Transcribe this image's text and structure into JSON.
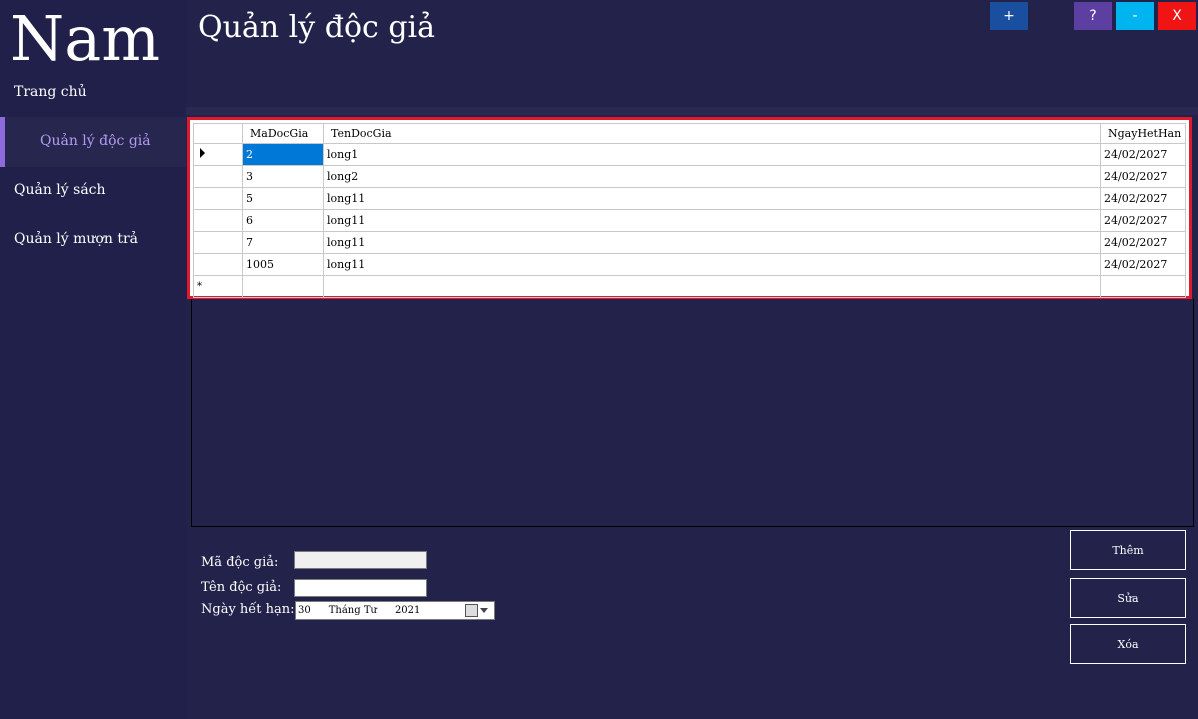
{
  "sidebar": {
    "logo": "Nam",
    "items": [
      {
        "label": "Trang chủ"
      },
      {
        "label": "Quản lý độc giả"
      },
      {
        "label": "Quản lý sách"
      },
      {
        "label": "Quản lý mượn trả"
      }
    ],
    "active_index": 1
  },
  "header": {
    "title": "Quản lý độc giả",
    "buttons": {
      "add": "+",
      "help": "?",
      "minimize": "-",
      "close": "X"
    }
  },
  "grid": {
    "columns": [
      "MaDocGia",
      "TenDocGia",
      "NgayHetHan"
    ],
    "rows": [
      [
        "2",
        "long1",
        "24/02/2027"
      ],
      [
        "3",
        "long2",
        "24/02/2027"
      ],
      [
        "5",
        "long11",
        "24/02/2027"
      ],
      [
        "6",
        "long11",
        "24/02/2027"
      ],
      [
        "7",
        "long11",
        "24/02/2027"
      ],
      [
        "1005",
        "long11",
        "24/02/2027"
      ]
    ],
    "new_row_marker": "*"
  },
  "form": {
    "ma_label": "Mã độc giả:",
    "ten_label": "Tên độc giả:",
    "ngay_label": "Ngày hết hạn:",
    "ma_value": "",
    "ten_value": "",
    "date": {
      "day": "30",
      "month": "Tháng Tư",
      "year": "2021"
    }
  },
  "actions": {
    "them": "Thêm",
    "sua": "Sửa",
    "xoa": "Xóa"
  },
  "colors": {
    "background": "#22224a",
    "accent": "#8e6bdc",
    "highlight_border": "#e01a2a",
    "add_button": "#1a4fa0",
    "help_button": "#5c3fa0",
    "minimize_button": "#00b4f0",
    "close_button": "#f01414"
  }
}
